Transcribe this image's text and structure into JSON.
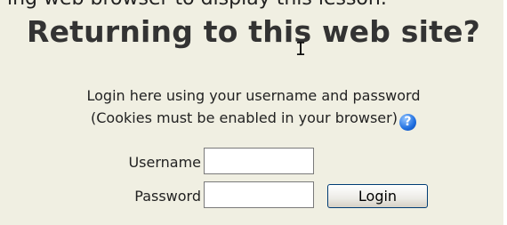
{
  "top_cut_text": "ing web browser to display this lesson.",
  "heading": "Returning to this web site?",
  "description": {
    "line1": "Login here using your username and password",
    "line2": "(Cookies must be enabled in your browser)"
  },
  "help_icon": {
    "icon": "help-question-icon",
    "glyph": "?"
  },
  "form": {
    "username_label": "Username",
    "username_value": "",
    "password_label": "Password",
    "password_value": "",
    "login_button": "Login"
  },
  "colors": {
    "panel_background": "#f0efe2",
    "heading_text": "#333333",
    "help_icon": "#1f6fe0"
  }
}
